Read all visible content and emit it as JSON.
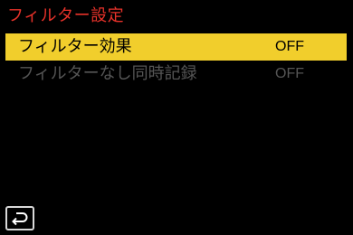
{
  "screen": {
    "title": "フィルター設定"
  },
  "menu": {
    "items": [
      {
        "label": "フィルター効果",
        "value": "OFF",
        "state": "selected"
      },
      {
        "label": "フィルターなし同時記録",
        "value": "OFF",
        "state": "disabled"
      }
    ]
  },
  "icons": {
    "back": "return-arrow-icon"
  },
  "colors": {
    "title": "#e8322a",
    "highlight": "#f1ce2c",
    "disabled_text": "#555555",
    "background": "#000000"
  }
}
